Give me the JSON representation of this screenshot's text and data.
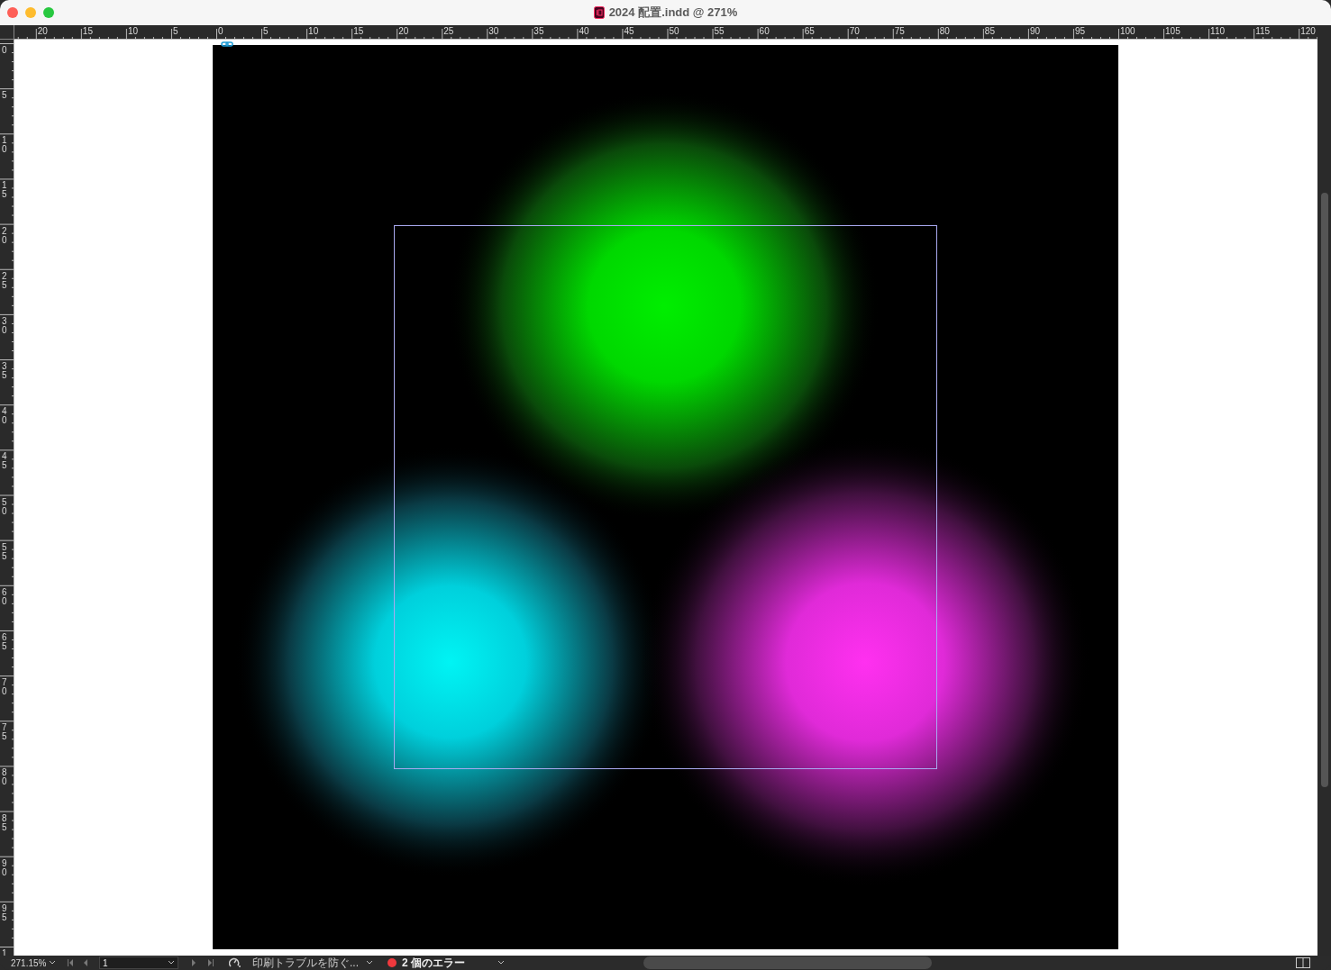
{
  "window": {
    "title": "2024 配置.indd @ 271%"
  },
  "rulers": {
    "horizontal": [
      "20",
      "15",
      "10",
      "5",
      "0",
      "5",
      "10",
      "15",
      "20",
      "25",
      "30",
      "35",
      "40",
      "45",
      "50",
      "55",
      "60",
      "65",
      "70",
      "75",
      "80",
      "85",
      "90",
      "95",
      "100",
      "105",
      "110",
      "115",
      "120"
    ],
    "vertical": [
      "0",
      "5",
      "10",
      "15",
      "20",
      "25",
      "30",
      "35",
      "40",
      "45",
      "50",
      "55",
      "60",
      "65",
      "70",
      "75",
      "80",
      "85",
      "90",
      "95",
      "1"
    ]
  },
  "status_bar": {
    "zoom": "271.15%",
    "page_number": "1",
    "preflight_profile": "印刷トラブルを防ぐ...",
    "errors": "2 個のエラー"
  }
}
